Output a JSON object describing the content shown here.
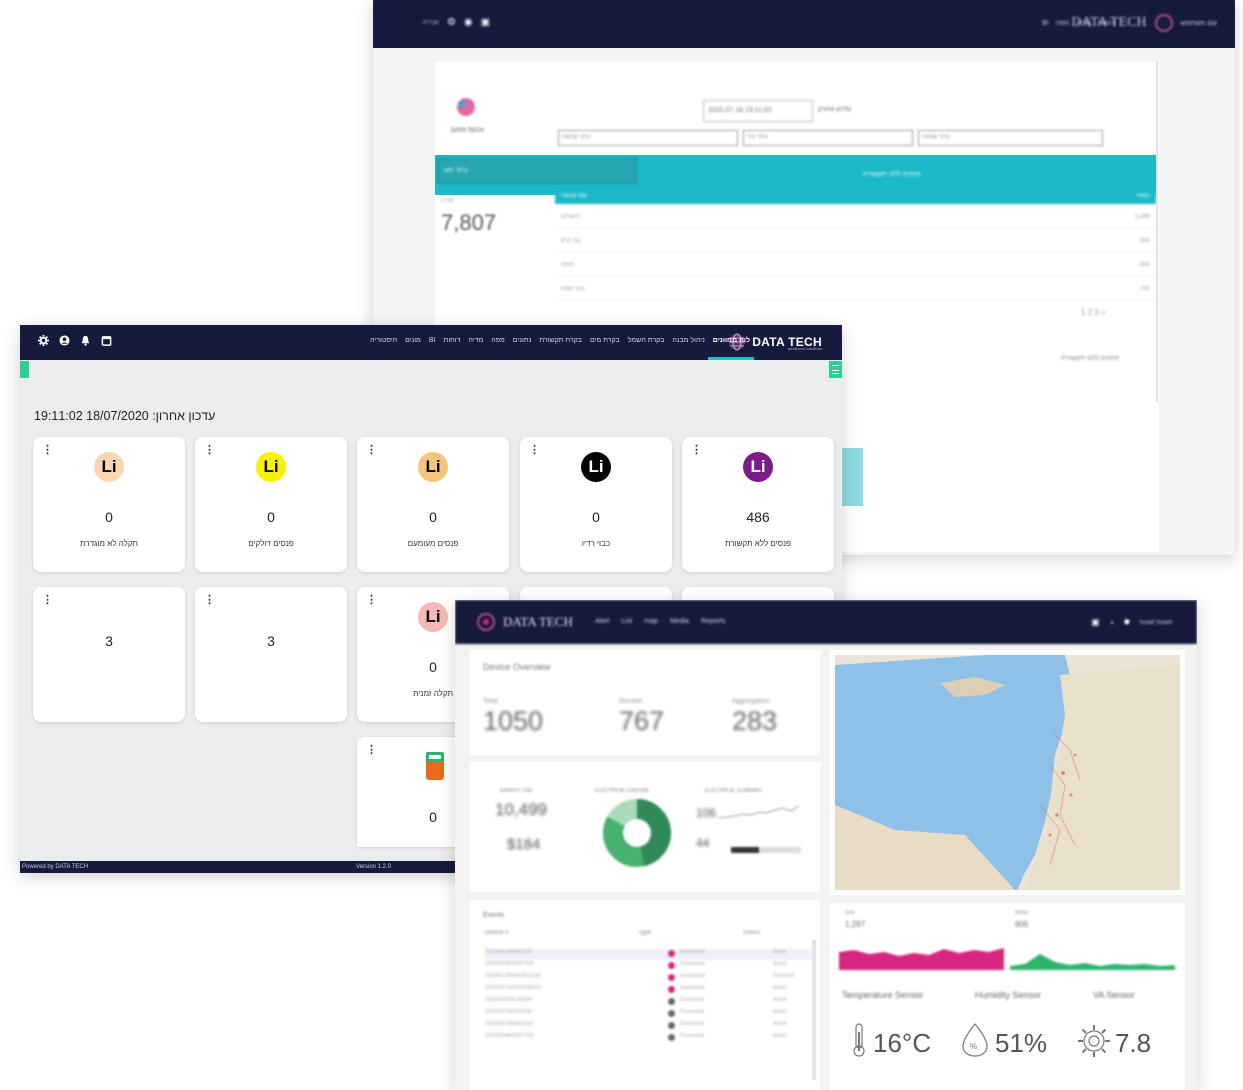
{
  "back_window": {
    "brand": "DATA TECH",
    "nav_items": [
      "BI",
      "מפה",
      "מדיה",
      "דוחות"
    ],
    "user_text": "שם משתמש",
    "date_value": "2020.07.18 19:11:02",
    "date_label": "עדכון אחרון",
    "filters": [
      "בחר קבוצה",
      "בחר עיר",
      "בחר שכונה"
    ],
    "teal_select": "בחר סוג",
    "teal_title": "פנסים ללא תקשורת",
    "table_header_left": "שם קבוצה",
    "table_header_right": "כמות",
    "total_label": "סה\"כ",
    "total_value": "7,807",
    "rows": [
      {
        "name": "ירושלים",
        "count": "1,400"
      },
      {
        "name": "בני ברק",
        "count": "900"
      },
      {
        "name": "חיפה",
        "count": "800"
      },
      {
        "name": "באר שבע",
        "count": "700"
      }
    ],
    "pager": "1 2 3 >",
    "side_text": "פנסים ללא תקשורת"
  },
  "middle_window": {
    "brand": "DATA TECH",
    "brand_sub": "advanced solutions",
    "menu": [
      "לוח מחוונים",
      "ניהול מבנה",
      "בקרת חשמל",
      "בקרת מים",
      "בקרת תקשורת",
      "נתונים",
      "מפה",
      "מדיה",
      "דוחות",
      "BI",
      "מונים",
      "היסטוריה"
    ],
    "updated_label": "עדכון אחרון: 18/07/2020 19:11:02",
    "cards_row1": [
      {
        "badge": "Li",
        "badge_color": "#7b1c88",
        "badge_text_color": "#ffffff",
        "value": "486",
        "label": "פנסים ללא תקשורת"
      },
      {
        "badge": "Li",
        "badge_color": "#050505",
        "badge_text_color": "#ffffff",
        "value": "0",
        "label": "כבוי רדיו"
      },
      {
        "badge": "Li",
        "badge_color": "#f6c57c",
        "badge_text_color": "#000000",
        "value": "0",
        "label": "פנסים מעומעם"
      },
      {
        "badge": "Li",
        "badge_color": "#f8f200",
        "badge_text_color": "#000000",
        "value": "0",
        "label": "פנסים דולקים"
      },
      {
        "badge": "Li",
        "badge_color": "#f9d6b2",
        "badge_text_color": "#000000",
        "value": "0",
        "label": "תקלה לא מוגדרת"
      }
    ],
    "cards_row2": [
      {
        "value": "3"
      },
      {
        "value": "3"
      },
      {
        "badge": "Li",
        "badge_color": "#f5b8b6",
        "badge_text_color": "#000000",
        "value": "0",
        "label": "תקלה זמנית"
      }
    ],
    "card_row3_value": "0",
    "footer_powered": "Powered by  DATA TECH",
    "footer_version": "Version 1.2.0"
  },
  "front_window": {
    "brand": "DATA TECH",
    "nav_items": [
      "Alert",
      "List",
      "map",
      "Media",
      "Reports"
    ],
    "user_text": "Israel Israeli",
    "device_overview": "Device Overview",
    "stats": [
      {
        "label": "Total",
        "value": "1050"
      },
      {
        "label": "Monitor",
        "value": "767"
      },
      {
        "label": "Aggregation",
        "value": "283"
      }
    ],
    "energy_labels": [
      "ENERGY USE",
      "ELECTRICAL USE/USE",
      "ELECTRICAL SUMMARY"
    ],
    "energy_value": "10,499",
    "cost_value": "$184",
    "summary_values": [
      "106",
      "44"
    ],
    "events_title": "Events",
    "events_cols": [
      "Device #",
      "Type",
      "Status"
    ],
    "events": [
      {
        "id": "19264001483482318",
        "type": "Anomalous",
        "status": "Active",
        "dot": "#d6267f"
      },
      {
        "id": "193500048493927HN",
        "type": "Anomalous",
        "status": "Active",
        "dot": "#d6267f"
      },
      {
        "id": "19435017806463621233",
        "type": "Anomalous",
        "status": "Resolved",
        "dot": "#d6267f"
      },
      {
        "id": "19354017161046338018",
        "type": "Anomalous",
        "status": "Active",
        "dot": "#d6267f"
      },
      {
        "id": "19354019763748343",
        "type": "Processed",
        "status": "Active",
        "dot": "#666666"
      },
      {
        "id": "19354017961047939",
        "type": "Processed",
        "status": "Active",
        "dot": "#666666"
      },
      {
        "id": "19264001483482318",
        "type": "Processed",
        "status": "Active",
        "dot": "#666666"
      },
      {
        "id": "193500048493927HN",
        "type": "Processed",
        "status": "Active",
        "dot": "#666666"
      }
    ],
    "mini_charts": [
      {
        "label": "Grid",
        "value": "1,297"
      },
      {
        "label": "Water",
        "value": "905"
      }
    ],
    "sensors": [
      {
        "label": "Temperature Sensor",
        "value": "16°C"
      },
      {
        "label": "Humidity Sensor",
        "value": "51%"
      },
      {
        "label": "VA Sensor",
        "value": "7.8"
      }
    ],
    "colors": {
      "pink": "#d6267f",
      "green": "#2db36a",
      "navy": "#161a3c",
      "teal": "#1cb9c8"
    }
  }
}
